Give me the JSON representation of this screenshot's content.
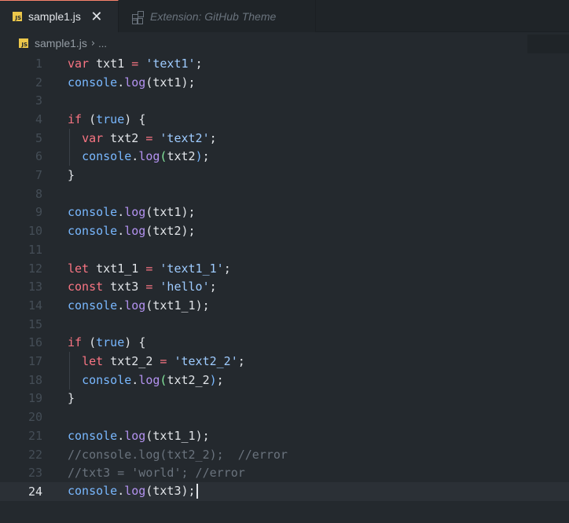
{
  "tabs": [
    {
      "label": "sample1.js",
      "icon": "js-file-icon",
      "icon_text": "JS",
      "active": true
    },
    {
      "label": "Extension: GitHub Theme",
      "icon": "extension-icon",
      "active": false
    }
  ],
  "breadcrumb": {
    "file": "sample1.js",
    "separator": "›",
    "more": "..."
  },
  "editor": {
    "current_line": 24,
    "line_numbers": [
      "1",
      "2",
      "3",
      "4",
      "5",
      "6",
      "7",
      "8",
      "9",
      "10",
      "11",
      "12",
      "13",
      "14",
      "15",
      "16",
      "17",
      "18",
      "19",
      "20",
      "21",
      "22",
      "23",
      "24"
    ],
    "lines": [
      "var txt1 = 'text1';",
      "console.log(txt1);",
      "",
      "if (true) {",
      "  var txt2 = 'text2';",
      "  console.log(txt2);",
      "}",
      "",
      "console.log(txt1);",
      "console.log(txt2);",
      "",
      "let txt1_1 = 'text1_1';",
      "const txt3 = 'hello';",
      "console.log(txt1_1);",
      "",
      "if (true) {",
      "  let txt2_2 = 'text2_2';",
      "  console.log(txt2_2);",
      "}",
      "",
      "console.log(txt1_1);",
      "//console.log(txt2_2);  //error",
      "//txt3 = 'world'; //error",
      "console.log(txt3);"
    ]
  },
  "colors": {
    "background": "#24292e",
    "tab_active_border": "#f9826c",
    "keyword": "#f97583",
    "string": "#9ecbff",
    "function": "#b392f0",
    "object": "#79b8ff",
    "comment": "#6a737d"
  }
}
